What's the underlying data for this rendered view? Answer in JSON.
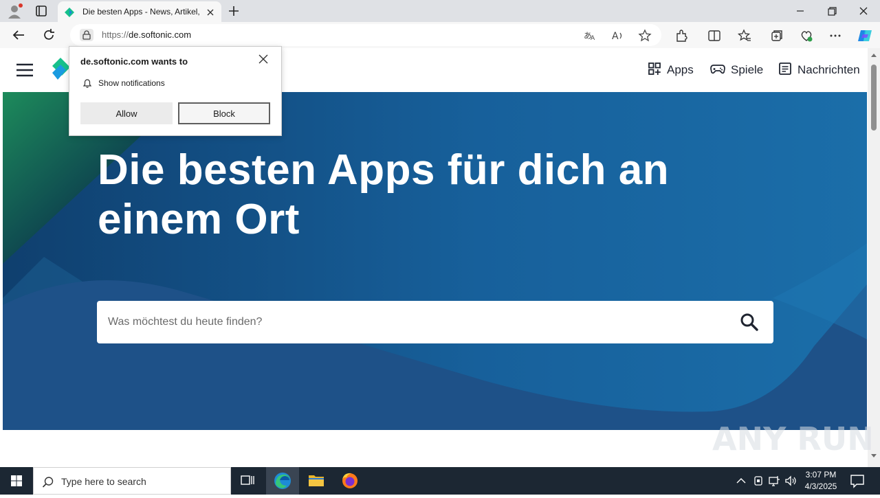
{
  "browser": {
    "tab_title": "Die besten Apps - News, Artikel, ",
    "url_scheme": "https://",
    "url_host": "de.softonic.com"
  },
  "page": {
    "nav": [
      {
        "label": "Apps",
        "icon": "grid-icon"
      },
      {
        "label": "Spiele",
        "icon": "gamepad-icon"
      },
      {
        "label": "Nachrichten",
        "icon": "newspaper-icon"
      }
    ],
    "hero_title": "Die besten Apps für dich an einem Ort",
    "search_placeholder": "Was möchtest du heute finden?"
  },
  "popup": {
    "title": "de.softonic.com wants to",
    "permission": "Show notifications",
    "allow_label": "Allow",
    "block_label": "Block"
  },
  "taskbar": {
    "search_placeholder": "Type here to search",
    "time": "3:07 PM",
    "date": "4/3/2025"
  },
  "watermark": "ANY RUN",
  "colors": {
    "hero_dark": "#0f3a6b",
    "hero_blue": "#1a6aa5",
    "hero_green": "#1f8a5a",
    "brand_teal": "#16c08b",
    "taskbar": "#1c2733"
  }
}
